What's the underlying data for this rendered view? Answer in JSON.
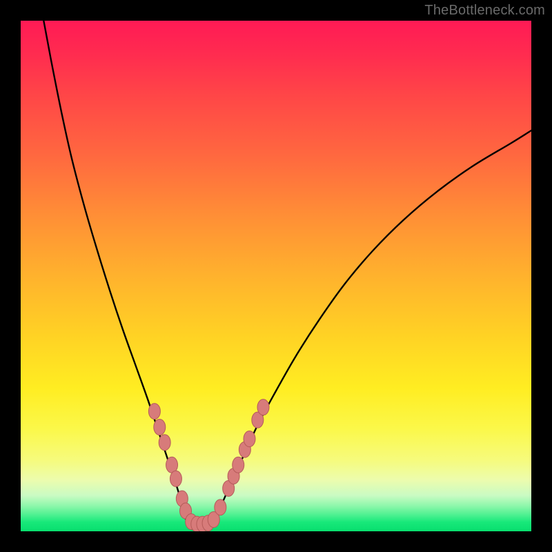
{
  "watermark": "TheBottleneck.com",
  "colors": {
    "curve": "#000000",
    "marker_fill": "#d77b7a",
    "marker_stroke": "#b55b59",
    "frame": "#000000"
  },
  "chart_data": {
    "type": "line",
    "title": "",
    "xlabel": "",
    "ylabel": "",
    "xlim": [
      0,
      100
    ],
    "ylim": [
      0,
      100
    ],
    "note": "No axis tick labels are visible; values below are pixel-normalized estimates (0–100) read from the figure geometry.",
    "series": [
      {
        "name": "bottleneck-curve-left",
        "x": [
          4.5,
          6,
          8,
          10,
          12.5,
          15,
          17.5,
          20,
          22.5,
          25,
          27,
          29,
          30.5,
          31.5,
          32,
          33
        ],
        "y": [
          100,
          92,
          82,
          73,
          63.5,
          55,
          47,
          39.5,
          32.5,
          25.5,
          19.5,
          13.5,
          9,
          5.5,
          3,
          1.5
        ]
      },
      {
        "name": "bottleneck-curve-flat",
        "x": [
          33,
          34,
          35,
          36,
          37.5
        ],
        "y": [
          1.5,
          1.2,
          1.1,
          1.2,
          1.6
        ]
      },
      {
        "name": "bottleneck-curve-right",
        "x": [
          37.5,
          39,
          41,
          43.5,
          46.5,
          50,
          54,
          58.5,
          63.5,
          69,
          75,
          81.5,
          88.5,
          96,
          100
        ],
        "y": [
          1.6,
          4.5,
          9,
          14.5,
          21,
          27.5,
          34.5,
          41.5,
          48.5,
          55,
          61,
          66.5,
          71.5,
          76,
          78.5
        ]
      }
    ],
    "markers": {
      "name": "highlight-dots",
      "points": [
        {
          "x": 26.2,
          "y": 23.5
        },
        {
          "x": 27.2,
          "y": 20.4
        },
        {
          "x": 28.2,
          "y": 17.4
        },
        {
          "x": 29.6,
          "y": 13.0
        },
        {
          "x": 30.4,
          "y": 10.3
        },
        {
          "x": 31.6,
          "y": 6.4
        },
        {
          "x": 32.3,
          "y": 4.0
        },
        {
          "x": 33.4,
          "y": 1.9
        },
        {
          "x": 34.5,
          "y": 1.4
        },
        {
          "x": 35.6,
          "y": 1.4
        },
        {
          "x": 36.7,
          "y": 1.6
        },
        {
          "x": 37.8,
          "y": 2.3
        },
        {
          "x": 39.1,
          "y": 4.7
        },
        {
          "x": 40.7,
          "y": 8.4
        },
        {
          "x": 41.7,
          "y": 10.8
        },
        {
          "x": 42.6,
          "y": 13.0
        },
        {
          "x": 43.9,
          "y": 16.0
        },
        {
          "x": 44.8,
          "y": 18.1
        },
        {
          "x": 46.4,
          "y": 21.8
        },
        {
          "x": 47.5,
          "y": 24.3
        }
      ]
    }
  }
}
